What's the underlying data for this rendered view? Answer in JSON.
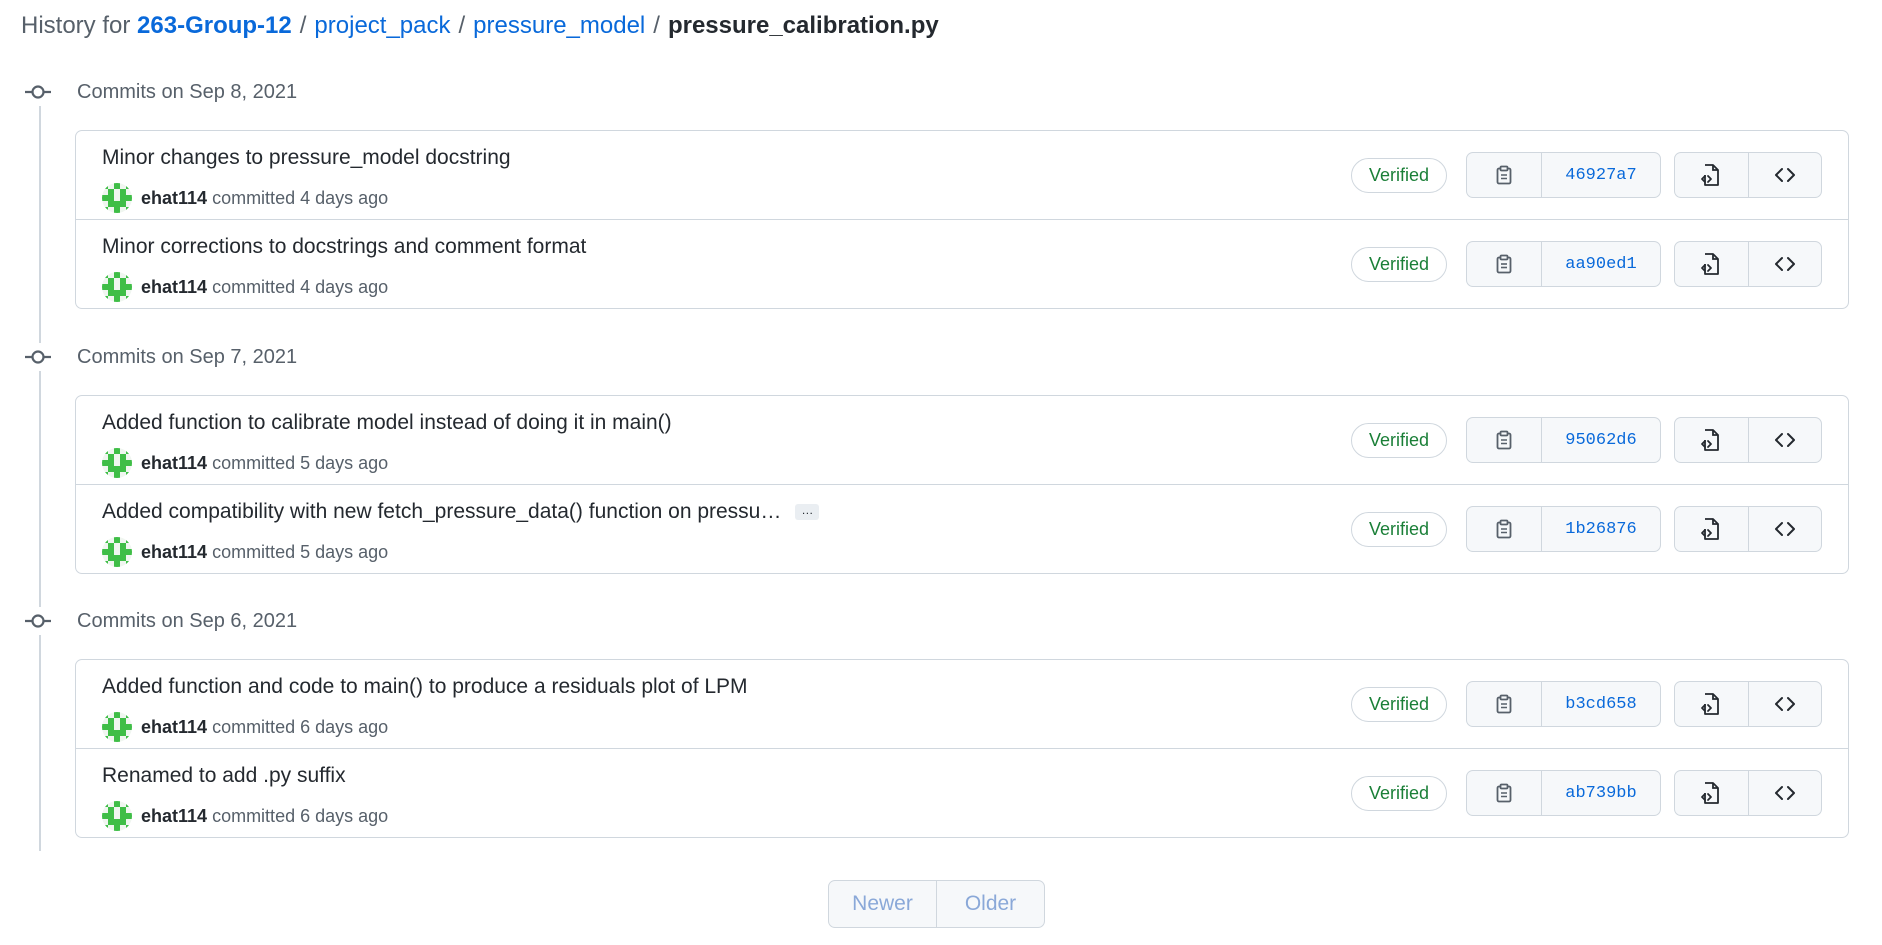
{
  "breadcrumb": {
    "prefix": "History for",
    "repo": "263-Group-12",
    "sep": "/",
    "path": [
      "project_pack",
      "pressure_model"
    ],
    "file": "pressure_calibration.py"
  },
  "groups": [
    {
      "title": "Commits on Sep 8, 2021",
      "commits": [
        {
          "message": "Minor changes to pressure_model docstring",
          "author": "ehat114",
          "action": "committed",
          "time": "4 days ago",
          "badge": "Verified",
          "sha": "46927a7"
        },
        {
          "message": "Minor corrections to docstrings and comment format",
          "author": "ehat114",
          "action": "committed",
          "time": "4 days ago",
          "badge": "Verified",
          "sha": "aa90ed1"
        }
      ]
    },
    {
      "title": "Commits on Sep 7, 2021",
      "commits": [
        {
          "message": "Added function to calibrate model instead of doing it in main()",
          "author": "ehat114",
          "action": "committed",
          "time": "5 days ago",
          "badge": "Verified",
          "sha": "95062d6"
        },
        {
          "message": "Added compatibility with new fetch_pressure_data() function on pressu…",
          "ellipsis": "…",
          "author": "ehat114",
          "action": "committed",
          "time": "5 days ago",
          "badge": "Verified",
          "sha": "1b26876"
        }
      ]
    },
    {
      "title": "Commits on Sep 6, 2021",
      "commits": [
        {
          "message": "Added function and code to main() to produce a residuals plot of LPM",
          "author": "ehat114",
          "action": "committed",
          "time": "6 days ago",
          "badge": "Verified",
          "sha": "b3cd658"
        },
        {
          "message": "Renamed to add .py suffix",
          "author": "ehat114",
          "action": "committed",
          "time": "6 days ago",
          "badge": "Verified",
          "sha": "ab739bb"
        }
      ]
    }
  ],
  "icons": {
    "node": "git-commit-icon",
    "copy": "clipboard-copy-icon",
    "browse_file": "file-code-icon",
    "browse_repo": "code-icon"
  },
  "pagination": {
    "newer": "Newer",
    "older": "Older"
  },
  "colors": {
    "link": "#0969da",
    "verified": "#1a7f37",
    "border": "#d0d7de",
    "muted": "#57606a",
    "avatar_green": "#3fbe47"
  }
}
